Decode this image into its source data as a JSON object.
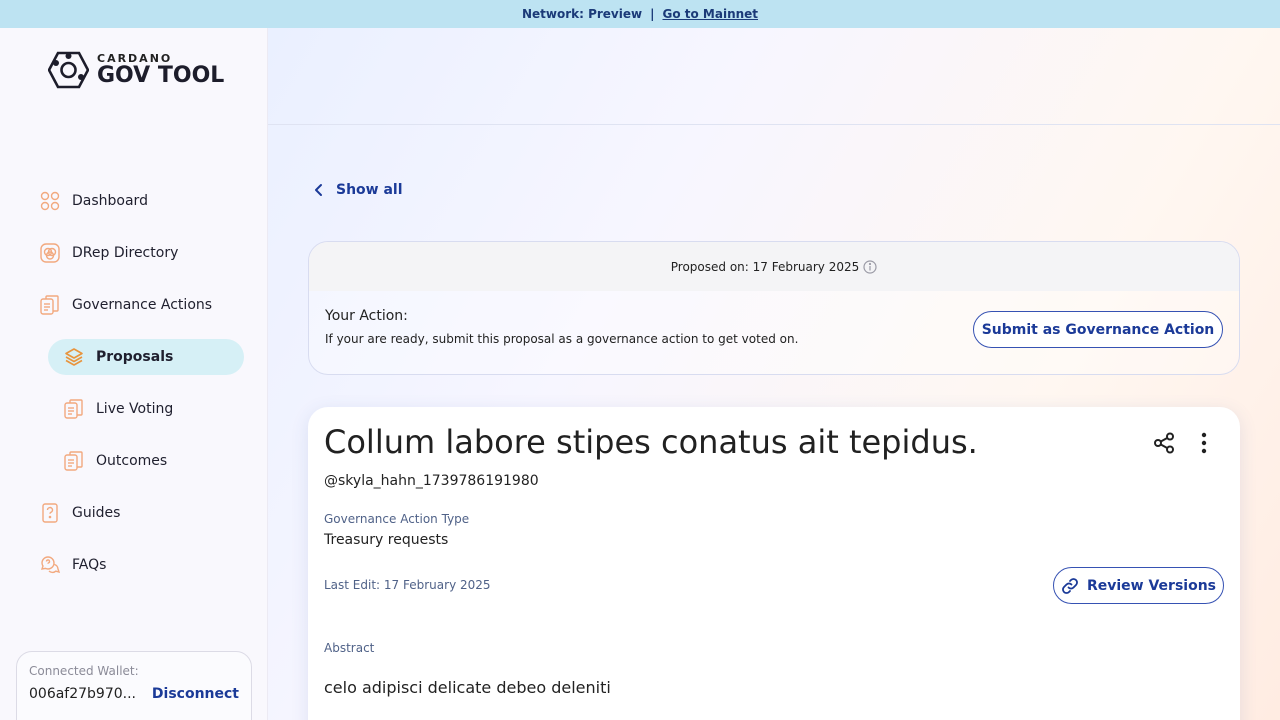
{
  "banner": {
    "network": "Network: Preview",
    "separator": "|",
    "link": "Go to Mainnet"
  },
  "logo": {
    "small": "CARDANO",
    "big": "GOV TOOL"
  },
  "sidebar": {
    "items": [
      {
        "label": "Dashboard"
      },
      {
        "label": "DRep Directory"
      },
      {
        "label": "Governance Actions"
      },
      {
        "label": "Proposals"
      },
      {
        "label": "Live Voting"
      },
      {
        "label": "Outcomes"
      },
      {
        "label": "Guides"
      },
      {
        "label": "FAQs"
      }
    ]
  },
  "wallet": {
    "label": "Connected Wallet:",
    "address": "006af27b970...",
    "disconnect": "Disconnect"
  },
  "nav": {
    "show_all": "Show all"
  },
  "action": {
    "proposed_on": "Proposed on: 17 February 2025",
    "title": "Your Action:",
    "description": "If your are ready, submit this proposal as a governance action to get voted on.",
    "submit_label": "Submit as Governance Action"
  },
  "proposal": {
    "title": "Collum labore stipes conatus ait tepidus.",
    "author": "@skyla_hahn_1739786191980",
    "type_label": "Governance Action Type",
    "type_value": "Treasury requests",
    "last_edit": "Last Edit: 17 February 2025",
    "review_versions": "Review Versions",
    "abstract_label": "Abstract",
    "abstract_value": "celo adipisci delicate debeo deleniti"
  },
  "colors": {
    "accent": "#1b3a98",
    "banner_bg": "#bde3f2",
    "active_nav_bg": "#d6f0f6",
    "icon_orange": "#f2a97f"
  }
}
